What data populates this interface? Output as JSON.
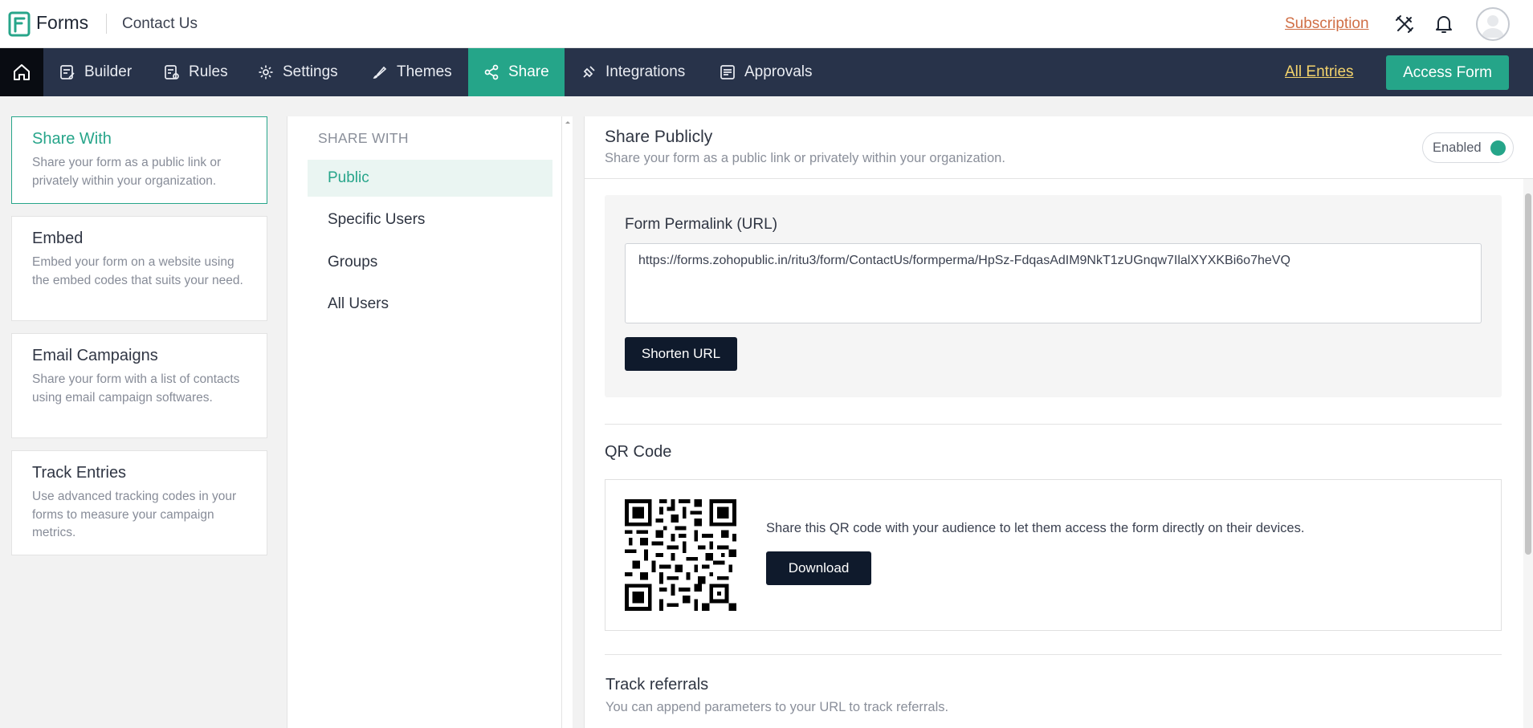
{
  "topbar": {
    "app_name": "Forms",
    "form_name": "Contact Us",
    "subscription": "Subscription"
  },
  "nav": {
    "items": [
      {
        "label": "Builder",
        "icon": "builder-icon"
      },
      {
        "label": "Rules",
        "icon": "rules-icon"
      },
      {
        "label": "Settings",
        "icon": "gear-icon"
      },
      {
        "label": "Themes",
        "icon": "brush-icon"
      },
      {
        "label": "Share",
        "icon": "share-icon",
        "active": true
      },
      {
        "label": "Integrations",
        "icon": "integrations-icon"
      },
      {
        "label": "Approvals",
        "icon": "approvals-icon"
      }
    ],
    "all_entries": "All Entries",
    "access_form": "Access Form"
  },
  "left_cards": [
    {
      "title": "Share With",
      "desc": "Share your form as a public link or privately within your organization.",
      "active": true
    },
    {
      "title": "Embed",
      "desc": "Embed your form on a website using the embed codes that suits your need."
    },
    {
      "title": "Email Campaigns",
      "desc": "Share your form with a list of contacts using email campaign softwares."
    },
    {
      "title": "Track Entries",
      "desc": "Use advanced tracking codes in your forms to measure your campaign metrics."
    }
  ],
  "share_with": {
    "heading": "SHARE WITH",
    "items": [
      "Public",
      "Specific Users",
      "Groups",
      "All Users"
    ],
    "active": "Public"
  },
  "share_publicly": {
    "title": "Share Publicly",
    "subtitle": "Share your form as a public link or privately within your organization.",
    "toggle_label": "Enabled",
    "toggle_on": true
  },
  "permalink": {
    "label": "Form Permalink (URL)",
    "url": "https://forms.zohopublic.in/ritu3/form/ContactUs/formperma/HpSz-FdqasAdIM9NkT1zUGnqw7IlalXYXKBi6o7heVQ",
    "shorten_label": "Shorten URL"
  },
  "qr": {
    "title": "QR Code",
    "text": "Share this QR code with your audience to let them access the form directly on their devices.",
    "download_label": "Download"
  },
  "track": {
    "title": "Track referrals",
    "subtitle": "You can append parameters to your URL to track referrals."
  },
  "colors": {
    "accent": "#25a589",
    "nav_bg": "#28334a",
    "dark_button": "#0f1a2c",
    "subscription": "#d06f46",
    "all_entries": "#f3d36c"
  }
}
